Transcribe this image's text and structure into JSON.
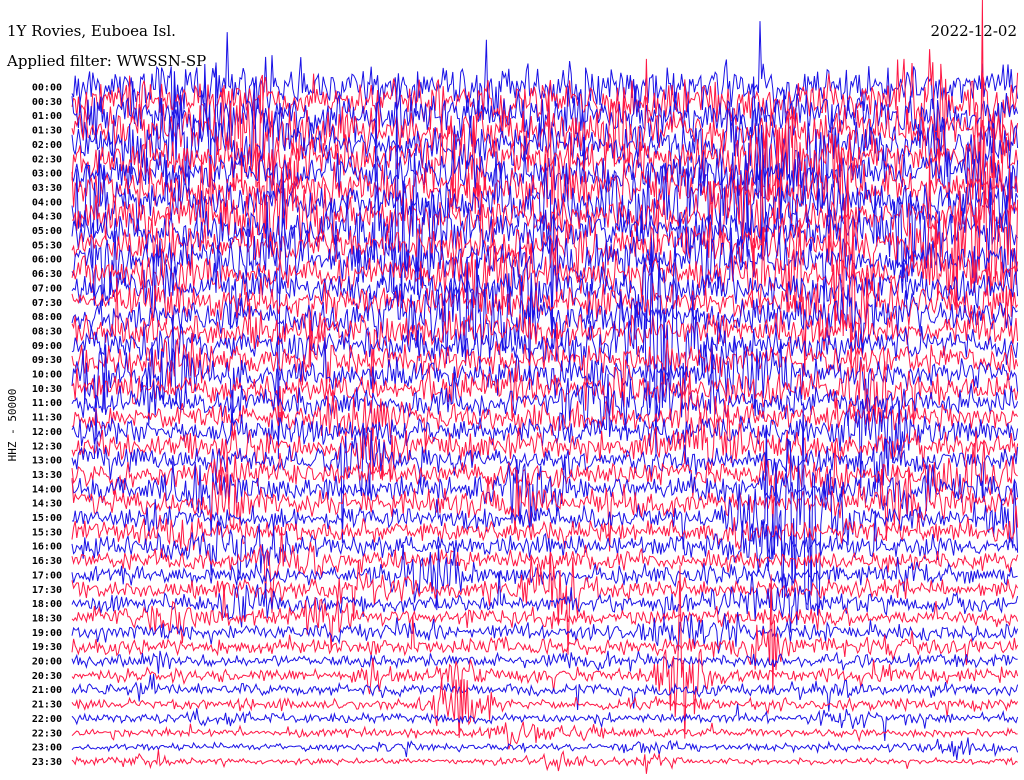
{
  "chart_data": {
    "type": "line",
    "title": "1Y Rovies, Euboea Isl.",
    "subtitle": "Applied filter: WWSSN-SP",
    "date": "2022-12-02",
    "ylabel": "HHZ - 50000",
    "xlabel": "",
    "row_labels": [
      "00:00",
      "00:30",
      "01:00",
      "01:30",
      "02:00",
      "02:30",
      "03:00",
      "03:30",
      "04:00",
      "04:30",
      "05:00",
      "05:30",
      "06:00",
      "06:30",
      "07:00",
      "07:30",
      "08:00",
      "08:30",
      "09:00",
      "09:30",
      "10:00",
      "10:30",
      "11:00",
      "11:30",
      "12:00",
      "12:30",
      "13:00",
      "13:30",
      "14:00",
      "14:30",
      "15:00",
      "15:30",
      "16:00",
      "16:30",
      "17:00",
      "17:30",
      "18:00",
      "18:30",
      "19:00",
      "19:30",
      "20:00",
      "20:30",
      "21:00",
      "21:30",
      "22:00",
      "22:30",
      "23:00",
      "23:30"
    ],
    "series_colors": [
      "#1a12e6",
      "#ff1744"
    ],
    "row_interval_minutes": 30,
    "grid": false
  }
}
